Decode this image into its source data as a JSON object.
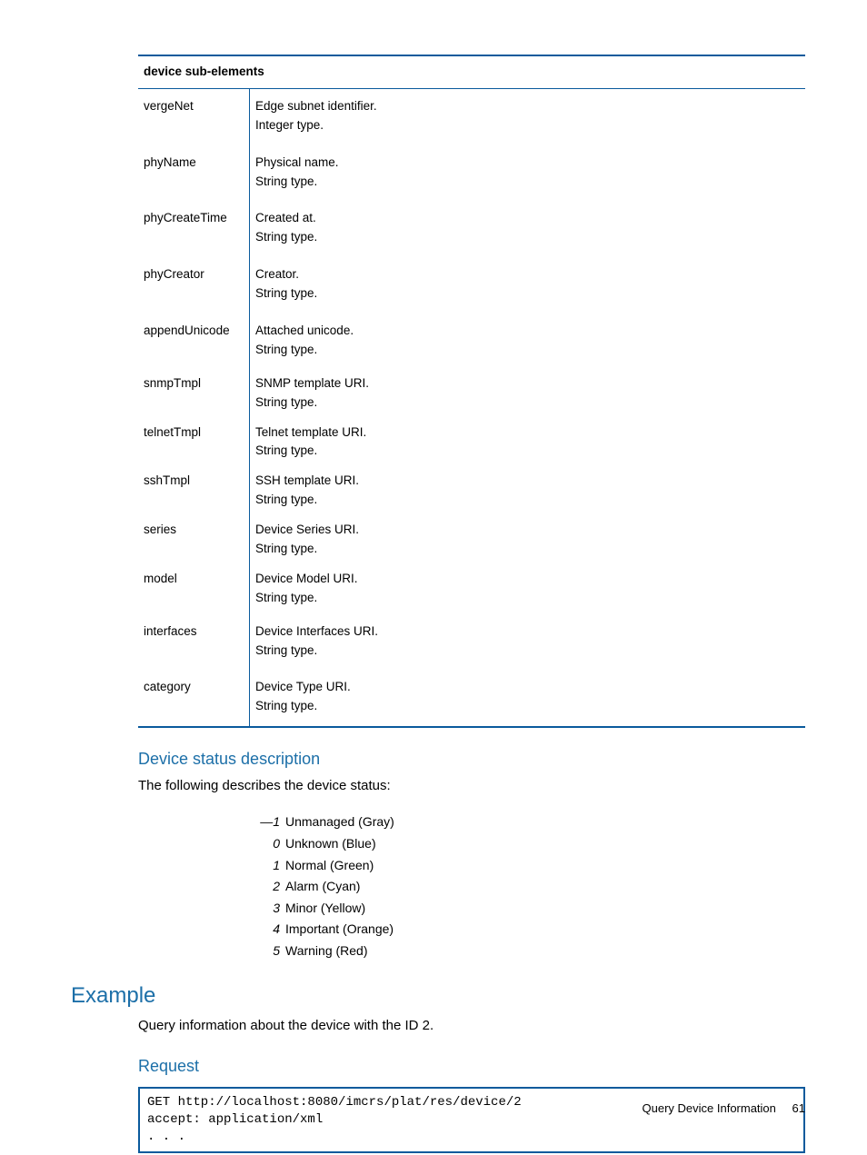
{
  "table": {
    "header": "device sub-elements",
    "rows": [
      {
        "name": "vergeNet",
        "lines": [
          "Edge subnet identifier.",
          "Integer type."
        ],
        "spaced": true
      },
      {
        "name": "phyName",
        "lines": [
          "Physical name.",
          "String type."
        ],
        "spaced": true
      },
      {
        "name": "phyCreateTime",
        "lines": [
          "Created at.",
          "String type."
        ],
        "spaced": true
      },
      {
        "name": "phyCreator",
        "lines": [
          "Creator.",
          "String type."
        ],
        "spaced": true
      },
      {
        "name": "appendUnicode",
        "lines": [
          "Attached unicode.",
          "String type."
        ],
        "spaced": true
      },
      {
        "name": "snmpTmpl",
        "lines": [
          "SNMP template URI.",
          "String type."
        ],
        "spaced": false
      },
      {
        "name": "telnetTmpl",
        "lines": [
          "Telnet template URI.",
          "String type."
        ],
        "spaced": false
      },
      {
        "name": "sshTmpl",
        "lines": [
          "SSH template URI.",
          "String type."
        ],
        "spaced": false
      },
      {
        "name": "series",
        "lines": [
          "Device Series URI.",
          "String type."
        ],
        "spaced": false
      },
      {
        "name": "model",
        "lines": [
          "Device Model URI.",
          "String type."
        ],
        "spaced": false
      },
      {
        "name": "interfaces",
        "lines": [
          "Device Interfaces URI.",
          "String type."
        ],
        "spaced": true
      },
      {
        "name": "category",
        "lines": [
          "Device Type URI.",
          "String type."
        ],
        "spaced": true
      }
    ]
  },
  "sections": {
    "status_heading": "Device status description",
    "status_intro": "The following describes the device status:",
    "example_heading": "Example",
    "example_intro": "Query information about the device with the ID 2.",
    "request_heading": "Request"
  },
  "status_list": [
    {
      "code": "—1",
      "label": "Unmanaged (Gray)"
    },
    {
      "code": "0",
      "label": "Unknown (Blue)"
    },
    {
      "code": "1",
      "label": "Normal (Green)"
    },
    {
      "code": "2",
      "label": "Alarm (Cyan)"
    },
    {
      "code": "3",
      "label": "Minor (Yellow)"
    },
    {
      "code": "4",
      "label": "Important (Orange)"
    },
    {
      "code": "5",
      "label": "Warning (Red)"
    }
  ],
  "code_block": "GET http://localhost:8080/imcrs/plat/res/device/2\naccept: application/xml\n. . .",
  "footer": {
    "title": "Query Device Information",
    "page": "61"
  }
}
